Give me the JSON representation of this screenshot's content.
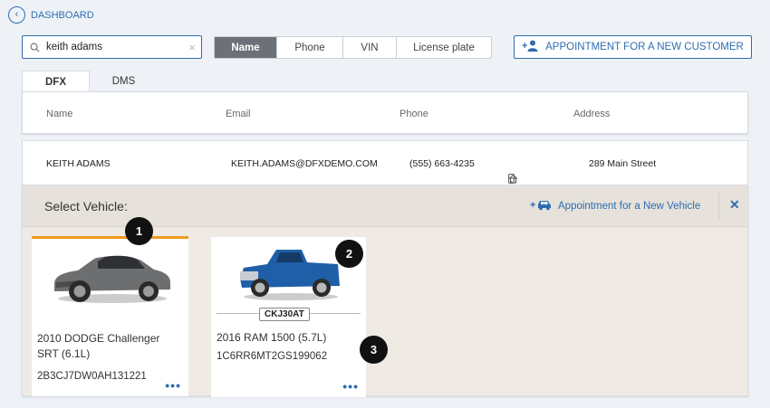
{
  "nav": {
    "back_label": "DASHBOARD"
  },
  "search": {
    "value": "keith adams",
    "placeholder": ""
  },
  "search_modes": [
    {
      "label": "Name",
      "active": true
    },
    {
      "label": "Phone",
      "active": false
    },
    {
      "label": "VIN",
      "active": false
    },
    {
      "label": "License plate",
      "active": false
    }
  ],
  "new_customer_button": "APPOINTMENT FOR A NEW CUSTOMER",
  "tabs": [
    "DFX",
    "DMS"
  ],
  "columns": [
    "Name",
    "Email",
    "Phone",
    "Address"
  ],
  "customer": {
    "name": "KEITH ADAMS",
    "email": "KEITH.ADAMS@DFXDEMO.COM",
    "phone": "(555) 663-4235",
    "address": "289 Main Street"
  },
  "vehicle_panel": {
    "label": "Select Vehicle:",
    "new_vehicle_label": "Appointment for a New Vehicle"
  },
  "vehicles": [
    {
      "title": "2010 DODGE Challenger SRT (6.1L)",
      "vin": "2B3CJ7DW0AH131221",
      "plate": "",
      "selected": true,
      "color": "#6d6e70"
    },
    {
      "title": "2016 RAM 1500 (5.7L)",
      "vin": "1C6RR6MT2GS199062",
      "plate": "CKJ30AT",
      "selected": false,
      "color": "#1f5fa8"
    }
  ],
  "markers": [
    "1",
    "2",
    "3"
  ],
  "colors": {
    "accent": "#2f6cb0",
    "selected": "#f39a1e"
  }
}
